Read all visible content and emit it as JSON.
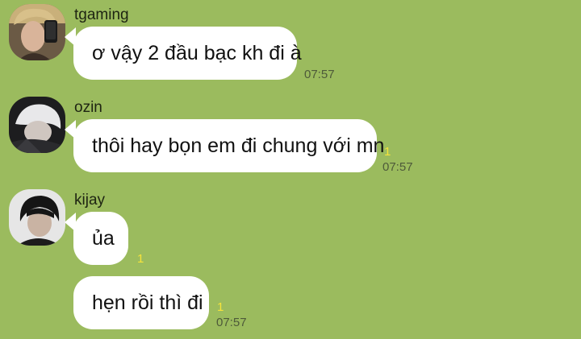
{
  "messages": [
    {
      "sender": "tgaming",
      "avatar_icon": "user-avatar-icon",
      "bubbles": [
        {
          "text": "ơ vậy 2 đầu bạc kh đi à",
          "unread": "",
          "time": "07:57"
        }
      ]
    },
    {
      "sender": "ozin",
      "avatar_icon": "user-avatar-icon",
      "bubbles": [
        {
          "text": "thôi hay bọn em đi chung với mn",
          "unread": "1",
          "time": "07:57"
        }
      ]
    },
    {
      "sender": "kijay",
      "avatar_icon": "user-avatar-icon",
      "bubbles": [
        {
          "text": "ủa",
          "unread": "1",
          "time": ""
        },
        {
          "text": "hẹn rồi thì đi",
          "unread": "1",
          "time": "07:57"
        }
      ]
    }
  ],
  "colors": {
    "background": "#9bbb5e",
    "bubble": "#ffffff",
    "unread": "#f6e33b",
    "time": "#4e5a3a"
  }
}
